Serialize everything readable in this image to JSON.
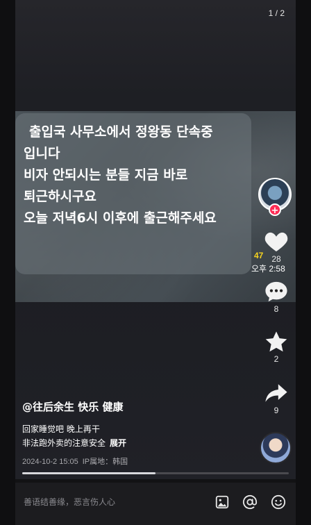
{
  "page_indicator": "1 / 2",
  "message": {
    "lines": [
      "출입국 사무소에서 정왕동 단속중",
      "입니다",
      "비자 안되시는 분들 지금 바로",
      "퇴근하시구요",
      "오늘 저녁6시 이후에 출근해주세요"
    ]
  },
  "overlay": {
    "badge": "47",
    "time": "오후 2:58"
  },
  "actions": {
    "follow_symbol": "+",
    "like_count": "28",
    "comment_count": "8",
    "favorite_count": "2",
    "share_count": "9"
  },
  "post": {
    "author": "@往后余生 快乐 健康",
    "desc_line1": "回家睡觉吧 晚上再干",
    "desc_line2": "非法跑外卖的注意安全",
    "expand": "展开",
    "date": "2024-10-2 15:05",
    "ip_location": "IP属地：韩国"
  },
  "progress": {
    "fraction": 0.5
  },
  "comment_bar": {
    "placeholder": "善语结善缘，恶言伤人心"
  },
  "icons": {
    "like": "heart-icon",
    "comment": "comment-icon",
    "favorite": "star-icon",
    "share": "share-icon",
    "image": "image-icon",
    "mention": "at-icon",
    "emoji": "emoji-icon"
  },
  "colors": {
    "follow_badge": "#fe2c55",
    "badge_text": "#f5d21f"
  }
}
